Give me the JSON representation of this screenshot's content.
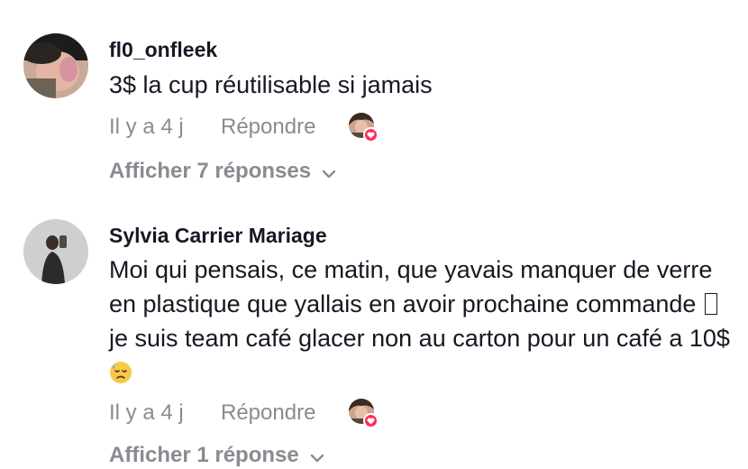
{
  "comments": [
    {
      "username": "fl0_onfleek",
      "text": "3$ la cup réutilisable si jamais",
      "time": "Il y a 4 j",
      "reply_label": "Répondre",
      "view_replies": "Afficher 7 réponses",
      "liked_by_creator": true
    },
    {
      "username": "Sylvia Carrier Mariage",
      "text_part1": "Moi qui pensais, ce matin, que yavais manquer de verre en plastique que yallais en avoir prochaine commande ",
      "text_part2": " je suis team café glacer non au carton pour un café a 10$",
      "text_emoji": "downcast-face-with-sweat-icon",
      "time": "Il y a 4 j",
      "reply_label": "Répondre",
      "view_replies": "Afficher 1 réponse",
      "liked_by_creator": true
    }
  ],
  "colors": {
    "primary_text": "#161823",
    "secondary_text": "#8a8b91",
    "heart_badge": "#fe2c55",
    "background": "#ffffff"
  }
}
